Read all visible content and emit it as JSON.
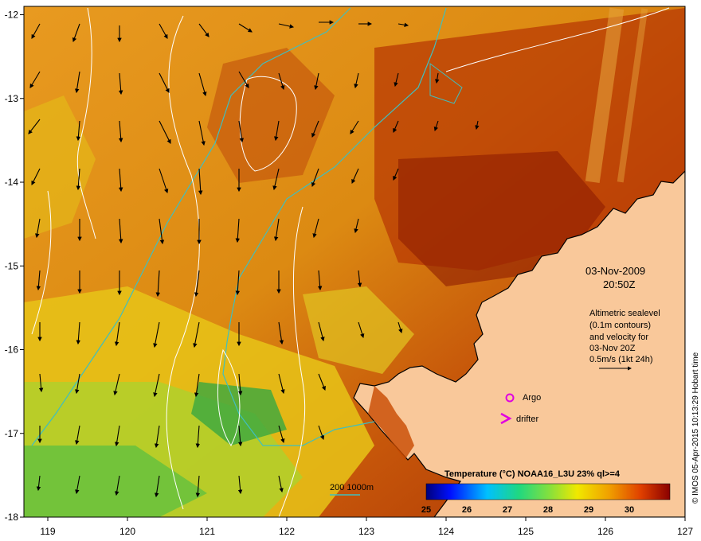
{
  "map": {
    "lon_ticks": [
      "119",
      "120",
      "121",
      "122",
      "123",
      "124",
      "125",
      "126",
      "127"
    ],
    "lat_ticks": [
      "-12",
      "-13",
      "-14",
      "-15",
      "-16",
      "-17",
      "-18"
    ],
    "lon_range": [
      118.7,
      127
    ],
    "lat_range": [
      -18,
      -11.9
    ]
  },
  "annotation": {
    "date": "03-Nov-2009",
    "time": "20:50Z",
    "altimetry_lines": [
      "Altimetric sealevel",
      "(0.1m contours)",
      "and velocity for",
      "03-Nov 20Z",
      "0.5m/s (1kt 24h)"
    ]
  },
  "legend": {
    "argo_label": "Argo",
    "drifter_label": "drifter",
    "depth_label": "200  1000m",
    "argo_color": "#e000e0",
    "drifter_color": "#e000e0",
    "depth_color": "#3fbfbf"
  },
  "colorbar": {
    "title": "Temperature (°C) NOAA16_L3U 23% ql>=4",
    "ticks": [
      "25",
      "26",
      "27",
      "28",
      "29",
      "30"
    ],
    "range": [
      25,
      31
    ]
  },
  "credit": "© IMOS 05-Apr-2015 10:13:29 Hobart time",
  "colors": {
    "land": "#f9c89a",
    "sst_warm": "#c84a00",
    "sst_mid": "#e89a1a",
    "sst_cool": "#7cc03c"
  }
}
